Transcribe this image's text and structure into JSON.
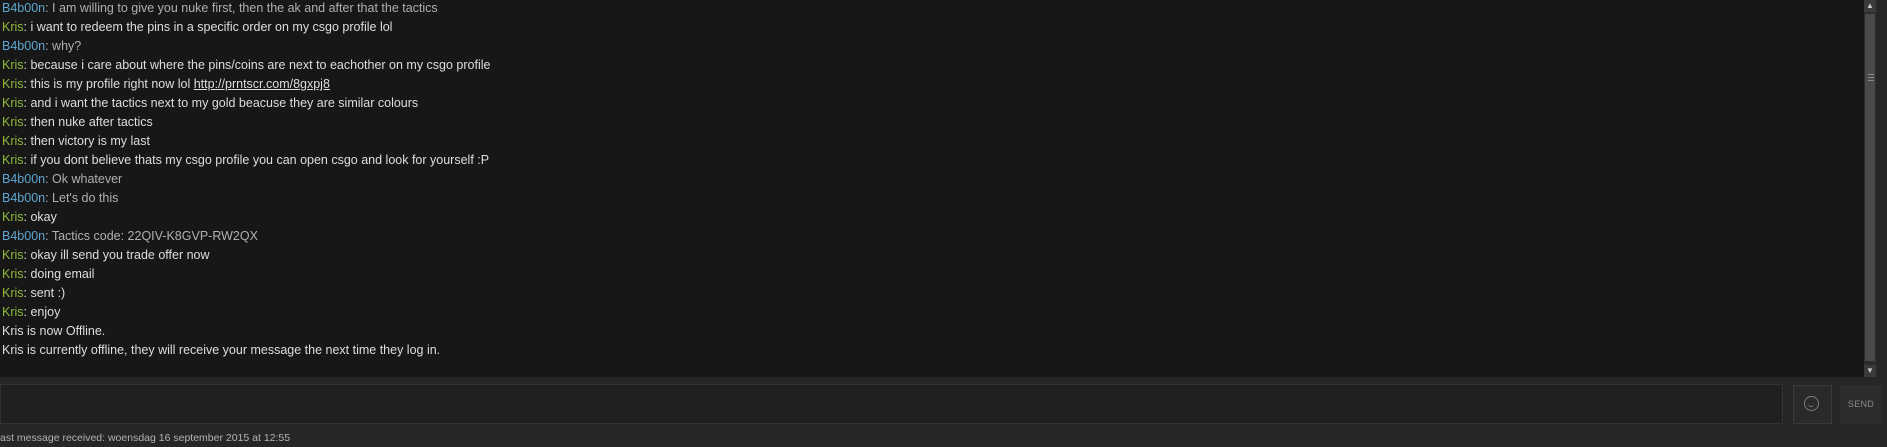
{
  "chat": {
    "lines": [
      {
        "sender": "B4b00n",
        "text": ": I am willing to give you nuke first, then the ak and after that the tactics"
      },
      {
        "sender": "Kris",
        "text": ": i want to redeem the pins in a specific order on my csgo profile lol"
      },
      {
        "sender": "B4b00n",
        "text": ": why?"
      },
      {
        "sender": "Kris",
        "text": ": because i care about where the pins/coins are next to eachother on my csgo profile"
      },
      {
        "sender": "Kris",
        "text": ": this is my profile right now lol ",
        "link": "http://prntscr.com/8gxpj8"
      },
      {
        "sender": "Kris",
        "text": ": and i want the tactics next to my gold beacuse they are similar colours"
      },
      {
        "sender": "Kris",
        "text": ": then nuke after tactics"
      },
      {
        "sender": "Kris",
        "text": ": then victory is my last"
      },
      {
        "sender": "Kris",
        "text": ": if you dont believe thats my csgo profile you can open csgo and look for yourself :P"
      },
      {
        "sender": "B4b00n",
        "text": ": Ok whatever"
      },
      {
        "sender": "B4b00n",
        "text": ": Let's do this"
      },
      {
        "sender": "Kris",
        "text": ": okay"
      },
      {
        "sender": "B4b00n",
        "text": ": Tactics code: 22QIV-K8GVP-RW2QX"
      },
      {
        "sender": "Kris",
        "text": ": okay ill send you trade offer now"
      },
      {
        "sender": "Kris",
        "text": ": doing email"
      },
      {
        "sender": "Kris",
        "text": ": sent :)"
      },
      {
        "sender": "Kris",
        "text": ": enjoy"
      }
    ],
    "system_messages": [
      "Kris is now Offline.",
      "Kris is currently offline, they will receive your message the next time they log in."
    ]
  },
  "input": {
    "value": "",
    "placeholder": ""
  },
  "emoticon_icon": "smiley-face-icon",
  "send_label": "SEND",
  "status": "ast message received: woensdag 16 september 2015 at 12:55",
  "colors": {
    "kris": "#8fb93b",
    "b4b00n": "#5ea6d1",
    "log_bg": "#171717"
  }
}
